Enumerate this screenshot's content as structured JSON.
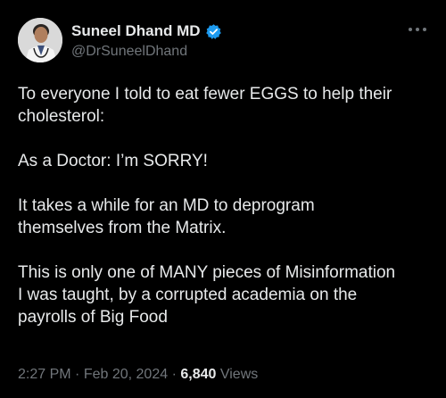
{
  "author": {
    "display_name": "Suneel Dhand MD",
    "handle": "@DrSuneelDhand",
    "verified_icon": "verified-badge-icon",
    "accent_color": "#1d9bf0"
  },
  "tweet": {
    "paragraphs": [
      "To everyone I told to eat fewer EGGS to help their\ncholesterol:",
      "As a Doctor: I’m SORRY!",
      "It takes a while for an MD to deprogram\nthemselves from the Matrix.",
      "This is only one of MANY pieces of Misinformation\nI was taught, by a corrupted academia on the\npayrolls of Big Food"
    ]
  },
  "meta": {
    "time": "2:27 PM",
    "separator": "·",
    "date": "Feb 20, 2024",
    "views_count": "6,840",
    "views_label": "Views"
  },
  "colors": {
    "background": "#000000",
    "primary_text": "#e7e9ea",
    "secondary_text": "#71767b"
  }
}
